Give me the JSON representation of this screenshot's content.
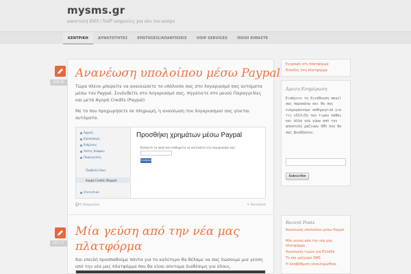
{
  "site": {
    "title": "mysms.gr",
    "description": "αποστολή SMS / VoIP υπηρεσίες για όλο τον κόσμο"
  },
  "nav": {
    "items": [
      "ΚΕΝΤΡΙΚΗ",
      "ΔΥΝΑΤΟΤΗΤΕΣ",
      "ΕΡΩΤΗΣΕΙΣ/ΑΠΑΝΤΗΣΕΙΣ",
      "VOIP SERVICES",
      "ΠΟΙΟΙ ΕΙΜΑΣΤΕ"
    ]
  },
  "posts": [
    {
      "date": "JUN 26",
      "title": "Ανανέωση υπολοίπου μέσω Paypal",
      "para1": "Τώρα πλέον μπορείτε να ανανεώσετε το υπόλοιπο σας στο λογαριασμό σας αυτόματα μέσω του Paypal. Συνδεθείτε στο λογαριασμό σας, πηγαίνετε στο μενού Παραγγελίες και μετά Αγορά Credits (Paypal).",
      "para2": "Με το που προχωρήσετε σε πληρωμή, η ανανέωση του λογαριασμού σας γίνεται αυτόματα.",
      "screenshot": {
        "heading": "Προσθήκη χρημάτων μέσω Paypal",
        "field_label": "Εισάγετε το ποσό που επιθυμείτε να πιστώσετε στο λογαριασμό σας:",
        "button": "Συνέχεια",
        "menu": [
          "Αρχική",
          "Επισκόπηση",
          "Ρυθμίσεις",
          "Λίστες Επαφών",
          "Παραγγελίες",
          "Προβολή όλων",
          "Αγορά Credits (Paypal)",
          "Στατιστικά"
        ]
      },
      "responses": "0 Responses",
      "permalink": "Permalink"
    },
    {
      "date": "OCT 27",
      "title": "Μία γεύση από την νέα μας πλατφόρμα",
      "para1": "Και επειδή προσπαθούμε πάντα για το καλύτερο θα θέλαμε να σας δώσουμε μια γεύση από την νέα μας πλατφόρμα που θα είναι σύντομα διαθέσιμη για όλους."
    }
  ],
  "sidebar": {
    "links": [
      "Εγγραφή στη πλατφόρμα",
      "Είσοδος στη πλατφόρμα"
    ],
    "subscribe": {
      "title": "Άμεση Ενημέρωση",
      "text": "Εισάγετε τη διεύθυνση email σας παρακάτω και θα σας ενημερώνουμε καθημερινά για τις εξέλιξη των τιμών καθώς και άλλα νέα γύρω από την αποστολή μαζικών SMS που θα σας βοηθήσουν.",
      "button": "Subscribe"
    },
    "recent": {
      "title": "Recent Posts",
      "items": [
        "Ανανέωση υπολοίπου μέσω Paypal",
        "Μία γεύση από την νέα μας πλατφόρμα",
        "Ανανέωση τιμών για Ελλάδα",
        "Το πιο γρήγορο SMS",
        "Η αναβάθμιση ολοκληρώθηκε"
      ]
    }
  },
  "colors": {
    "accent": "#e8673c",
    "header_bg": "#ebebeb",
    "page_bg": "#f1f1f1"
  }
}
